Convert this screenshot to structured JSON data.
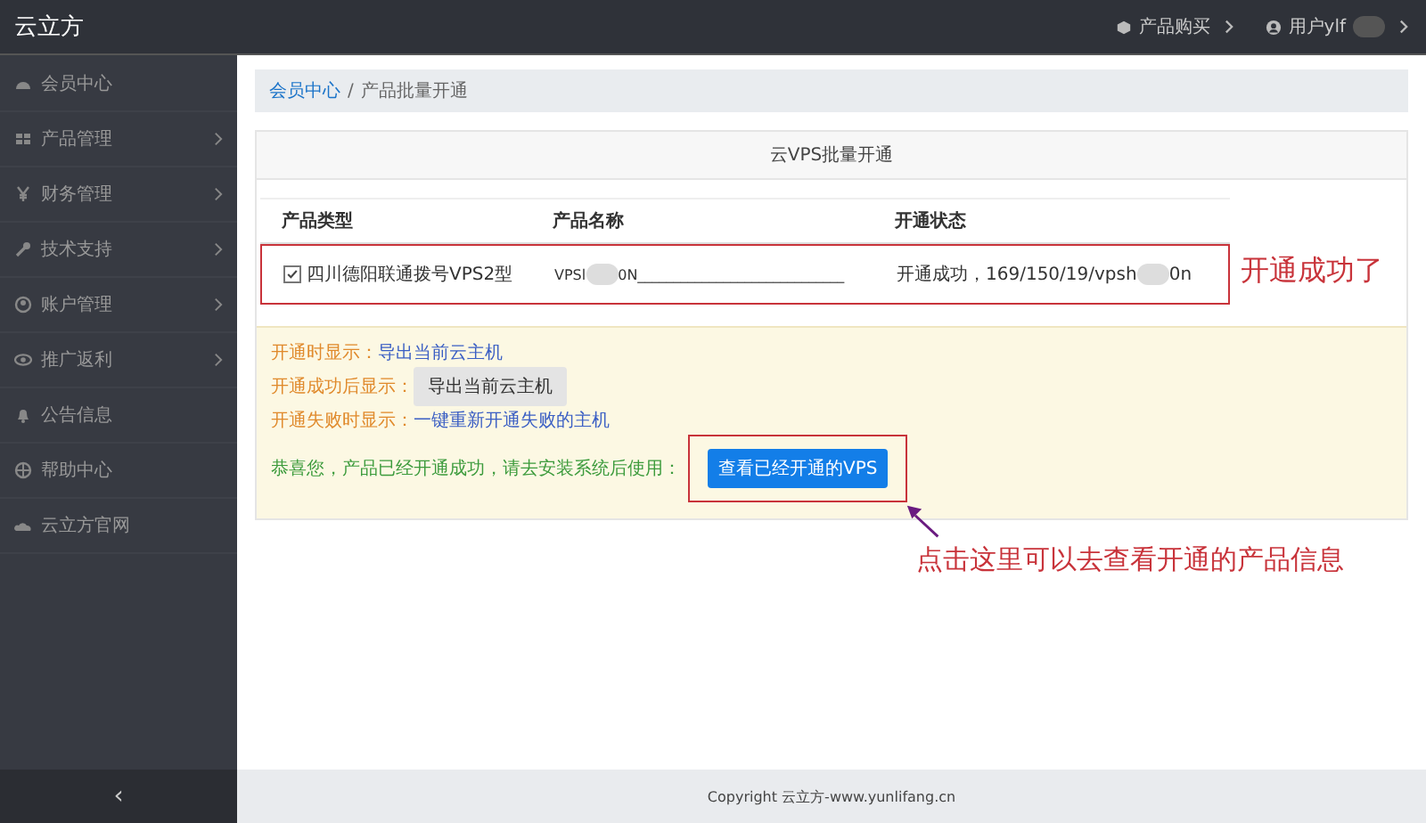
{
  "topbar": {
    "logo": "云立方",
    "menu": [
      {
        "label": "产品购买"
      },
      {
        "label": "用户ylf"
      }
    ]
  },
  "sidebar": {
    "items": [
      {
        "label": "会员中心",
        "has_submenu": false
      },
      {
        "label": "产品管理",
        "has_submenu": true
      },
      {
        "label": "财务管理",
        "has_submenu": true
      },
      {
        "label": "技术支持",
        "has_submenu": true
      },
      {
        "label": "账户管理",
        "has_submenu": true
      },
      {
        "label": "推广返利",
        "has_submenu": true
      },
      {
        "label": "公告信息",
        "has_submenu": false
      },
      {
        "label": "帮助中心",
        "has_submenu": false
      },
      {
        "label": "云立方官网",
        "has_submenu": false
      }
    ],
    "collapse": "‹"
  },
  "breadcrumb": [
    {
      "label": "会员中心"
    },
    {
      "label": "产品批量开通"
    }
  ],
  "breadcrumb_separator": "/",
  "card": {
    "title": "云VPS批量开通",
    "table": {
      "columns": [
        "产品类型",
        "产品名称",
        "开通状态"
      ],
      "rows": [
        {
          "checked": true,
          "type": "四川德阳联通拨号VPS2型",
          "name_start": "VPSl",
          "name_end": "0N_____________________________",
          "status_start": "开通成功，169/150/19/vpsh",
          "status_end": "0n"
        }
      ]
    }
  },
  "notice": [
    {
      "kind": "link",
      "label": "开通时显示：",
      "action": "导出当前云主机"
    },
    {
      "kind": "button",
      "label": "开通成功后显示：",
      "action": "导出当前云主机"
    },
    {
      "kind": "link",
      "label": "开通失败时显示：",
      "action": "一键重新开通失败的主机"
    },
    {
      "kind": "primary",
      "label": "恭喜您，产品已经开通成功，请去安装系统后使用：",
      "action": "查看已经开通的VPS"
    }
  ],
  "annotations": {
    "row_note": "开通成功了",
    "button_note": "点击这里可以去查看开通的产品信息"
  },
  "footer": "Copyright 云立方-www.yunlifang.cn"
}
